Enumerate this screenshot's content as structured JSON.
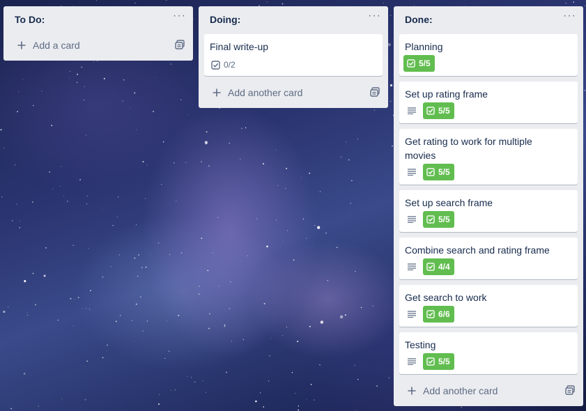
{
  "board": {
    "lists": [
      {
        "title": "To Do:",
        "menu": "···",
        "add_label": "Add a card",
        "cards": []
      },
      {
        "title": "Doing:",
        "menu": "···",
        "add_label": "Add another card",
        "cards": [
          {
            "title": "Final write-up",
            "has_description": false,
            "checklist": "0/2",
            "complete": false
          }
        ]
      },
      {
        "title": "Done:",
        "menu": "···",
        "add_label": "Add another card",
        "cards": [
          {
            "title": "Planning",
            "has_description": false,
            "checklist": "5/5",
            "complete": true
          },
          {
            "title": "Set up rating frame",
            "has_description": true,
            "checklist": "5/5",
            "complete": true
          },
          {
            "title": "Get rating to work for multiple movies",
            "has_description": true,
            "checklist": "5/5",
            "complete": true
          },
          {
            "title": "Set up search frame",
            "has_description": true,
            "checklist": "5/5",
            "complete": true
          },
          {
            "title": "Combine search and rating frame",
            "has_description": true,
            "checklist": "4/4",
            "complete": true
          },
          {
            "title": "Get search to work",
            "has_description": true,
            "checklist": "6/6",
            "complete": true
          },
          {
            "title": "Testing",
            "has_description": true,
            "checklist": "5/5",
            "complete": true
          }
        ]
      }
    ]
  },
  "colors": {
    "list_bg": "#ebecf0",
    "complete_badge": "#61bd4f",
    "text": "#172b4d",
    "muted": "#5e6c84"
  },
  "icons": {
    "add": "plus-icon",
    "template": "card-template-icon",
    "description": "description-icon",
    "checklist": "checklist-icon",
    "menu": "more-icon"
  }
}
